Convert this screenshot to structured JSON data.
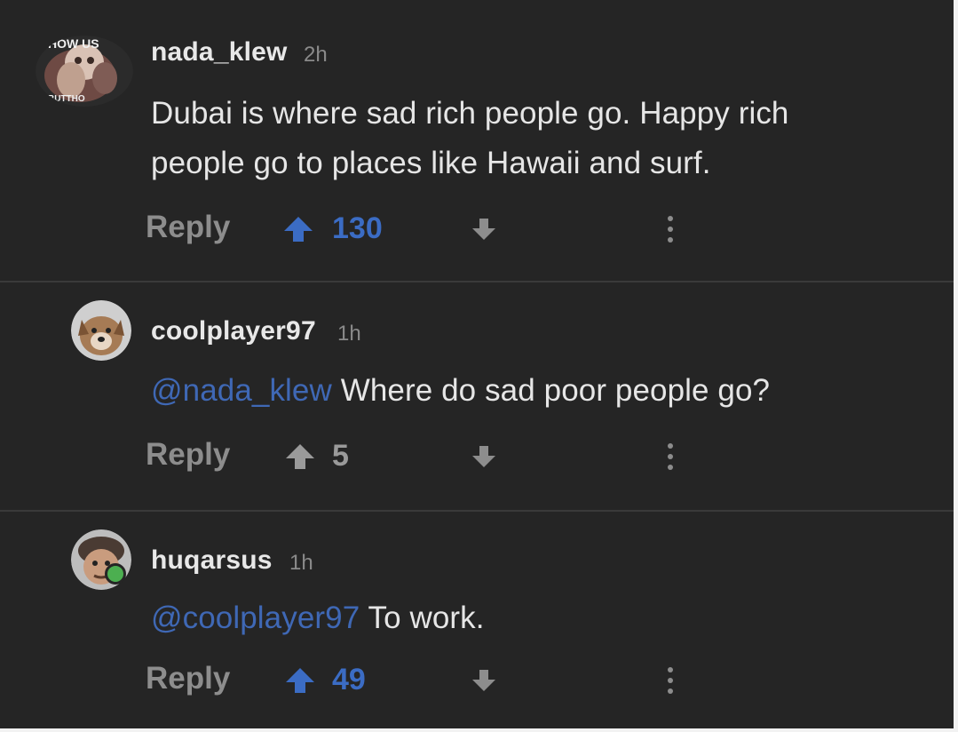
{
  "comments": [
    {
      "username": "nada_klew",
      "time": "2h",
      "mention": "",
      "text_line1": "Dubai is where sad rich people go. Happy rich",
      "text_line2": "people go to places like Hawaii and surf.",
      "reply_label": "Reply",
      "votes": "130",
      "upvoted": true,
      "avatar_text_top": "HOW US",
      "avatar_text_bottom": "BUTTHO"
    },
    {
      "username": "coolplayer97",
      "time": "1h",
      "mention": "@nada_klew",
      "text": "Where do sad poor people go?",
      "reply_label": "Reply",
      "votes": "5",
      "upvoted": false
    },
    {
      "username": "huqarsus",
      "time": "1h",
      "mention": "@coolplayer97",
      "text": "To work.",
      "reply_label": "Reply",
      "votes": "49",
      "upvoted": true
    }
  ],
  "colors": {
    "background": "#252525",
    "upvoted": "#3b6cc4",
    "mention": "#3f68b5",
    "muted": "#8d8d8d",
    "online": "#4caf50"
  },
  "icons": {
    "upvote": "arrow-up-icon",
    "downvote": "arrow-down-icon",
    "more": "vertical-dots-icon"
  }
}
